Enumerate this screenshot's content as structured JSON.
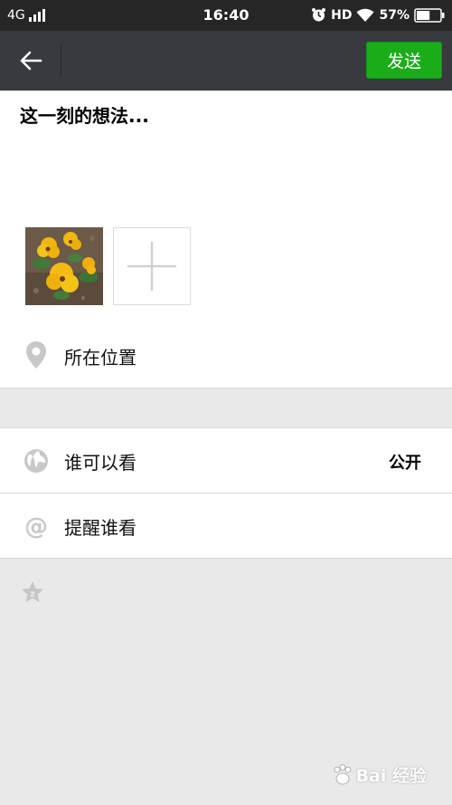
{
  "status_bar": {
    "network": "4G",
    "time": "16:40",
    "hd": "HD",
    "battery": "57%",
    "battery_level": 0.57
  },
  "toolbar": {
    "send_label": "发送"
  },
  "compose": {
    "placeholder": "这一刻的想法..."
  },
  "menu": {
    "location": "所在位置",
    "visibility": "谁可以看",
    "visibility_value": "公开",
    "remind": "提醒谁看"
  },
  "watermark": {
    "text": "Bai 经验"
  },
  "colors": {
    "send_button": "#1aad19",
    "toolbar": "#393a3f",
    "status_bar": "#262626"
  }
}
